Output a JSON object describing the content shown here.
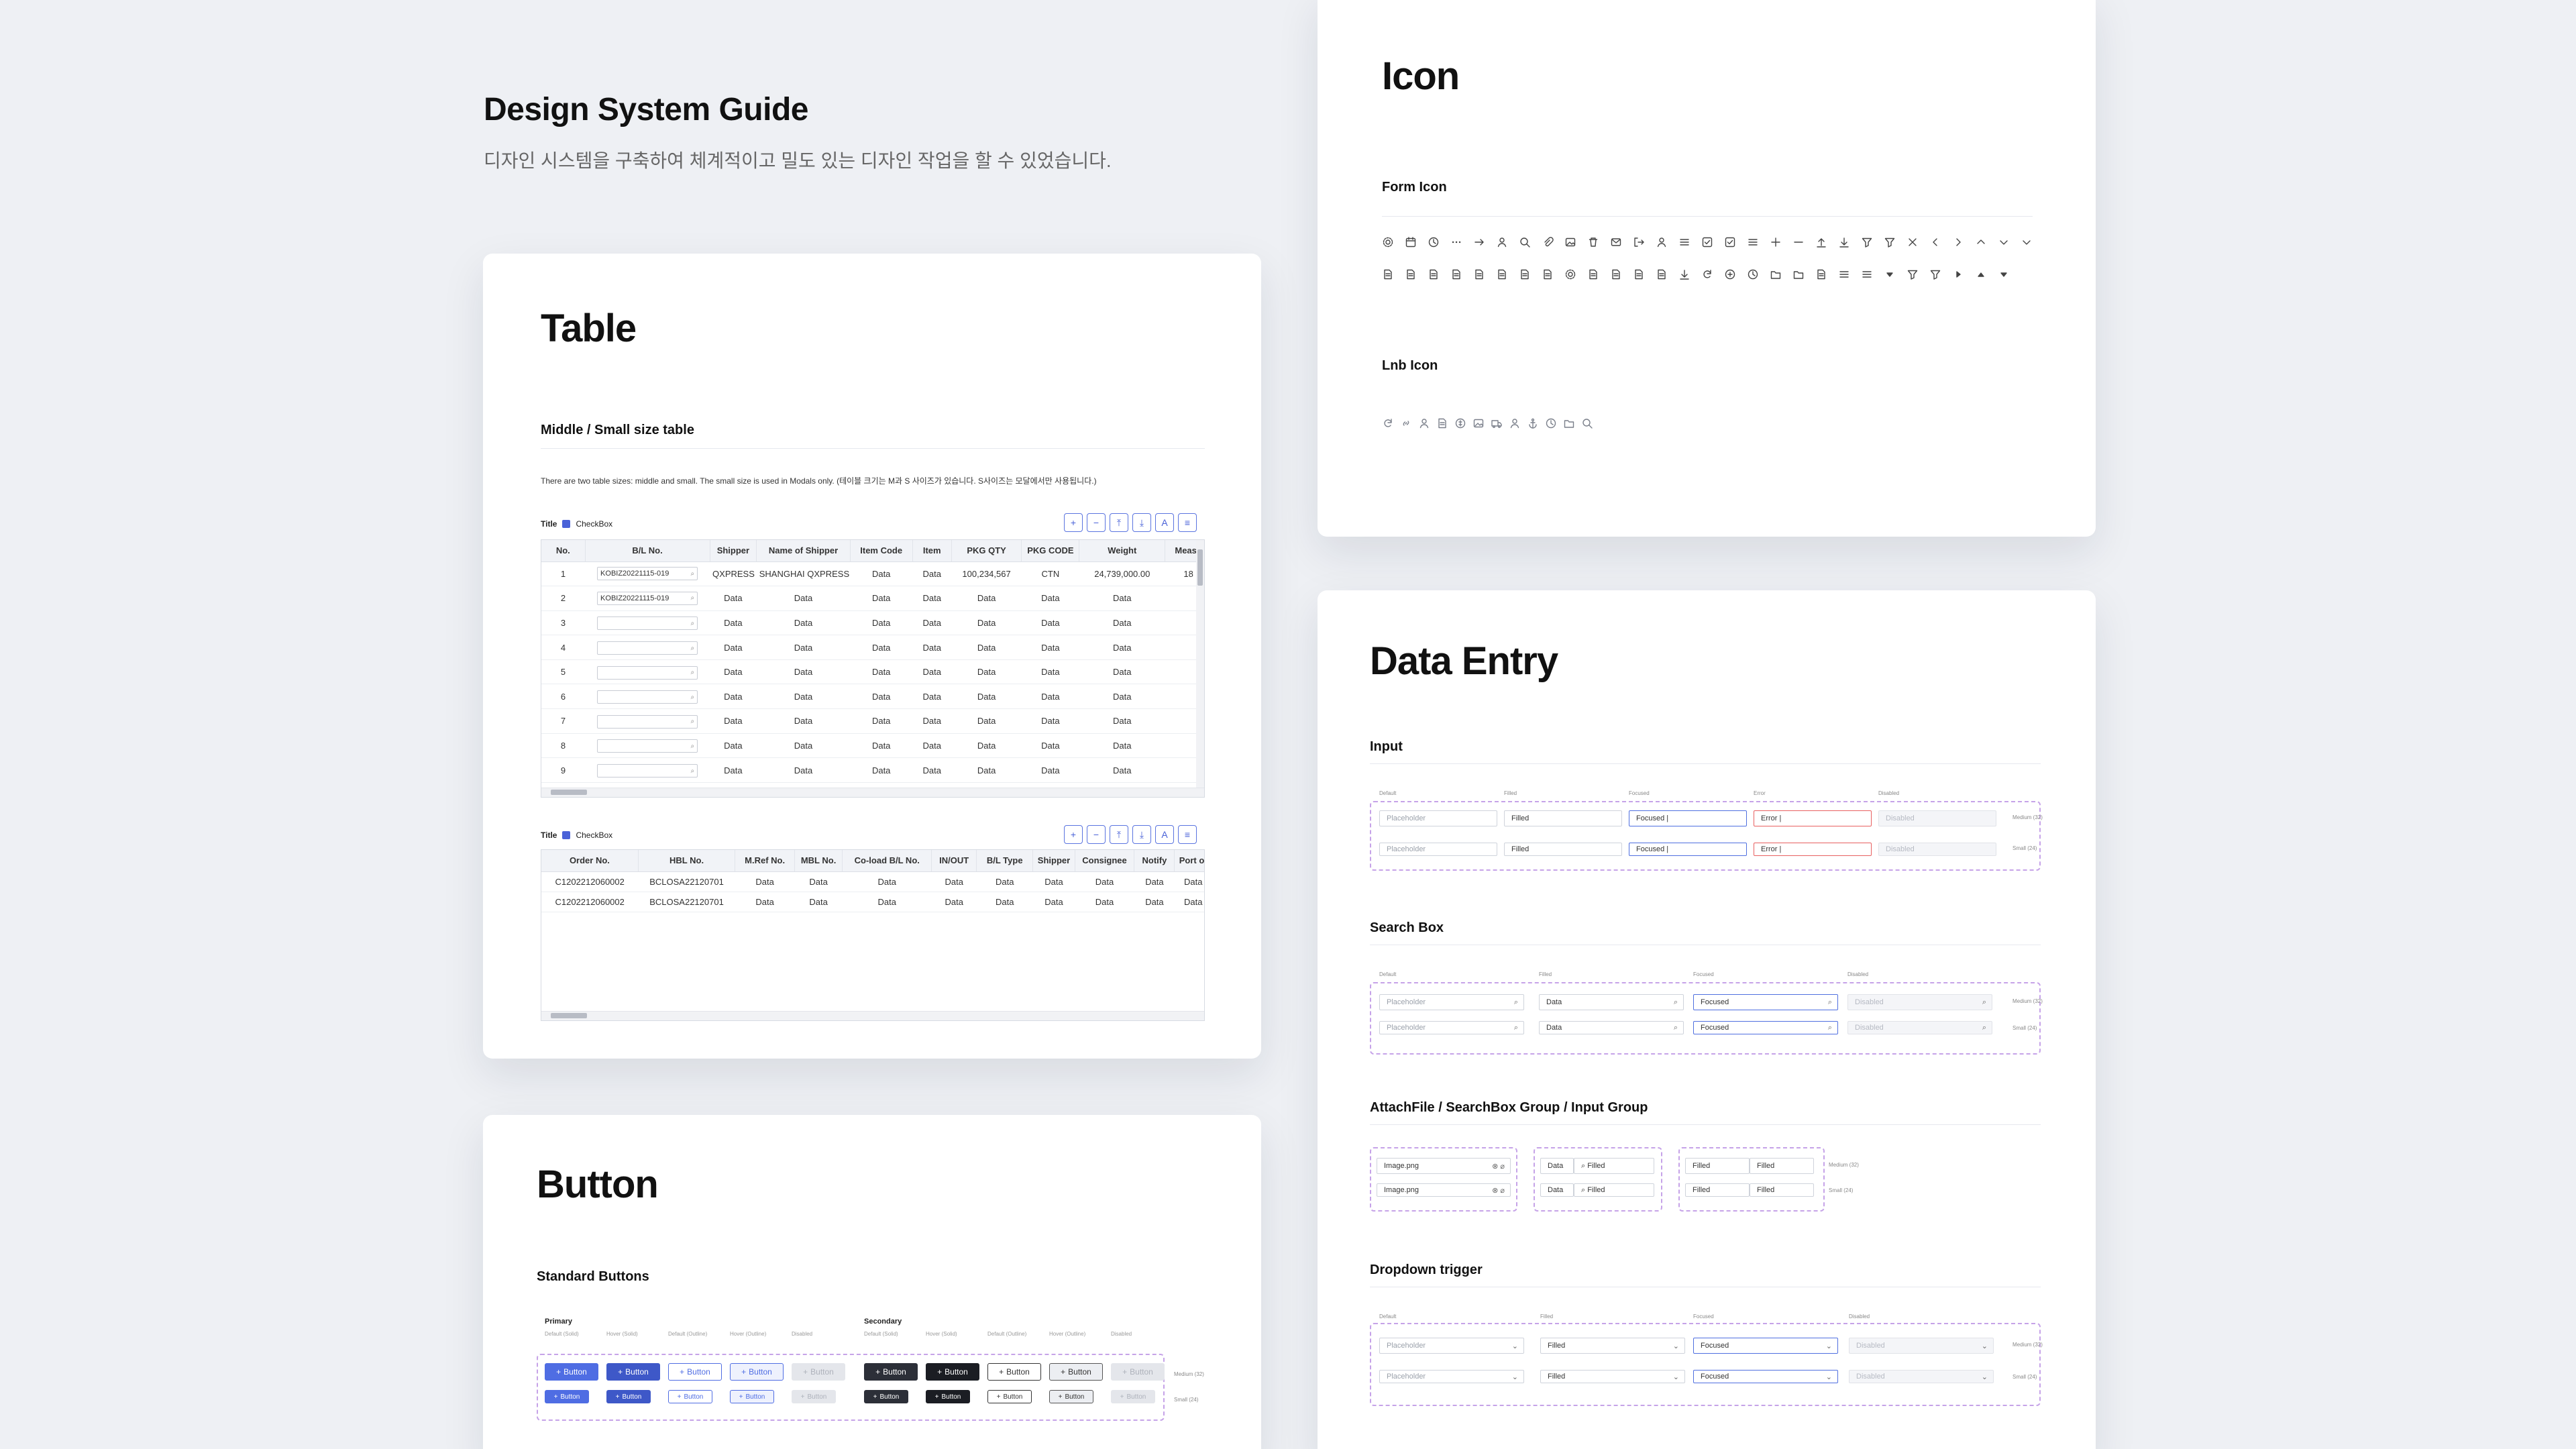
{
  "header": {
    "title": "Design System Guide",
    "subtitle": "디자인 시스템을 구축하여 체계적이고 밀도 있는 디자인 작업을 할 수 있었습니다."
  },
  "table_card": {
    "title": "Table",
    "section": "Middle / Small size table",
    "description": "There are two table sizes: middle and small. The small size is used in Modals only. (테이블 크기는 M과 S 사이즈가 있습니다. S사이즈는 모달에서만 사용됩니다.)",
    "table1": {
      "title": "Title",
      "checkbox_label": "CheckBox",
      "tools": [
        "+",
        "−",
        "⤒",
        "⤓",
        "A",
        "≡"
      ],
      "columns": [
        "No.",
        "B/L No.",
        "Shipper",
        "Name of Shipper",
        "Item Code",
        "Item",
        "PKG QTY",
        "PKG CODE",
        "Weight",
        "Measu"
      ],
      "rows": [
        [
          "1",
          "KOBIZ20221115-019",
          "QXPRESS",
          "SHANGHAI QXPRESS",
          "Data",
          "Data",
          "100,234,567",
          "CTN",
          "24,739,000.00",
          "18"
        ],
        [
          "2",
          "KOBIZ20221115-019",
          "Data",
          "Data",
          "Data",
          "Data",
          "Data",
          "Data",
          "Data",
          ""
        ],
        [
          "3",
          "",
          "Data",
          "Data",
          "Data",
          "Data",
          "Data",
          "Data",
          "Data",
          ""
        ],
        [
          "4",
          "",
          "Data",
          "Data",
          "Data",
          "Data",
          "Data",
          "Data",
          "Data",
          ""
        ],
        [
          "5",
          "",
          "Data",
          "Data",
          "Data",
          "Data",
          "Data",
          "Data",
          "Data",
          ""
        ],
        [
          "6",
          "",
          "Data",
          "Data",
          "Data",
          "Data",
          "Data",
          "Data",
          "Data",
          ""
        ],
        [
          "7",
          "",
          "Data",
          "Data",
          "Data",
          "Data",
          "Data",
          "Data",
          "Data",
          ""
        ],
        [
          "8",
          "",
          "Data",
          "Data",
          "Data",
          "Data",
          "Data",
          "Data",
          "Data",
          ""
        ],
        [
          "9",
          "",
          "Data",
          "Data",
          "Data",
          "Data",
          "Data",
          "Data",
          "Data",
          ""
        ]
      ]
    },
    "table2": {
      "title": "Title",
      "checkbox_label": "CheckBox",
      "tools": [
        "+",
        "−",
        "⤒",
        "⤓",
        "A",
        "≡"
      ],
      "columns": [
        "Order No.",
        "HBL No.",
        "M.Ref No.",
        "MBL No.",
        "Co-load B/L No.",
        "IN/OUT",
        "B/L Type",
        "Shipper",
        "Consignee",
        "Notify",
        "Port of"
      ],
      "rows": [
        [
          "C1202212060002",
          "BCLOSA22120701",
          "Data",
          "Data",
          "Data",
          "Data",
          "Data",
          "Data",
          "Data",
          "Data",
          "Data"
        ],
        [
          "C1202212060002",
          "BCLOSA22120701",
          "Data",
          "Data",
          "Data",
          "Data",
          "Data",
          "Data",
          "Data",
          "Data",
          "Data"
        ]
      ]
    }
  },
  "button_card": {
    "title": "Button",
    "section": "Standard Buttons",
    "primary_label": "Primary",
    "secondary_label": "Secondary",
    "states": [
      "Default (Solid)",
      "Hover (Solid)",
      "Default (Outline)",
      "Hover (Outline)",
      "Disabled"
    ],
    "button_label": "Button",
    "size_medium": "Medium (32)",
    "size_small": "Small (24)"
  },
  "icon_card": {
    "title": "Icon",
    "form_icon_label": "Form Icon",
    "lnb_icon_label": "Lnb Icon"
  },
  "data_entry_card": {
    "title": "Data Entry",
    "input_section": "Input",
    "input_states": [
      "Default",
      "Filled",
      "Focused",
      "Error",
      "Disabled"
    ],
    "input_values": [
      "Placeholder",
      "Filled",
      "Focused",
      "Error",
      "Disabled"
    ],
    "search_section": "Search Box",
    "search_states": [
      "Default",
      "Filled",
      "Focused",
      "Disabled"
    ],
    "search_values": [
      "Placeholder",
      "Data",
      "Focused",
      "Disabled"
    ],
    "attach_section": "AttachFile / SearchBox Group / Input Group",
    "attach_file": "Image.png",
    "group_data": "Data",
    "group_filled": "Filled",
    "dropdown_section": "Dropdown trigger",
    "dropdown_states": [
      "Default",
      "Filled",
      "Focused",
      "Disabled"
    ],
    "dropdown_values": [
      "Placeholder",
      "Filled",
      "Focused",
      "Disabled"
    ],
    "size_medium": "Medium (32)",
    "size_small": "Small (24)"
  }
}
